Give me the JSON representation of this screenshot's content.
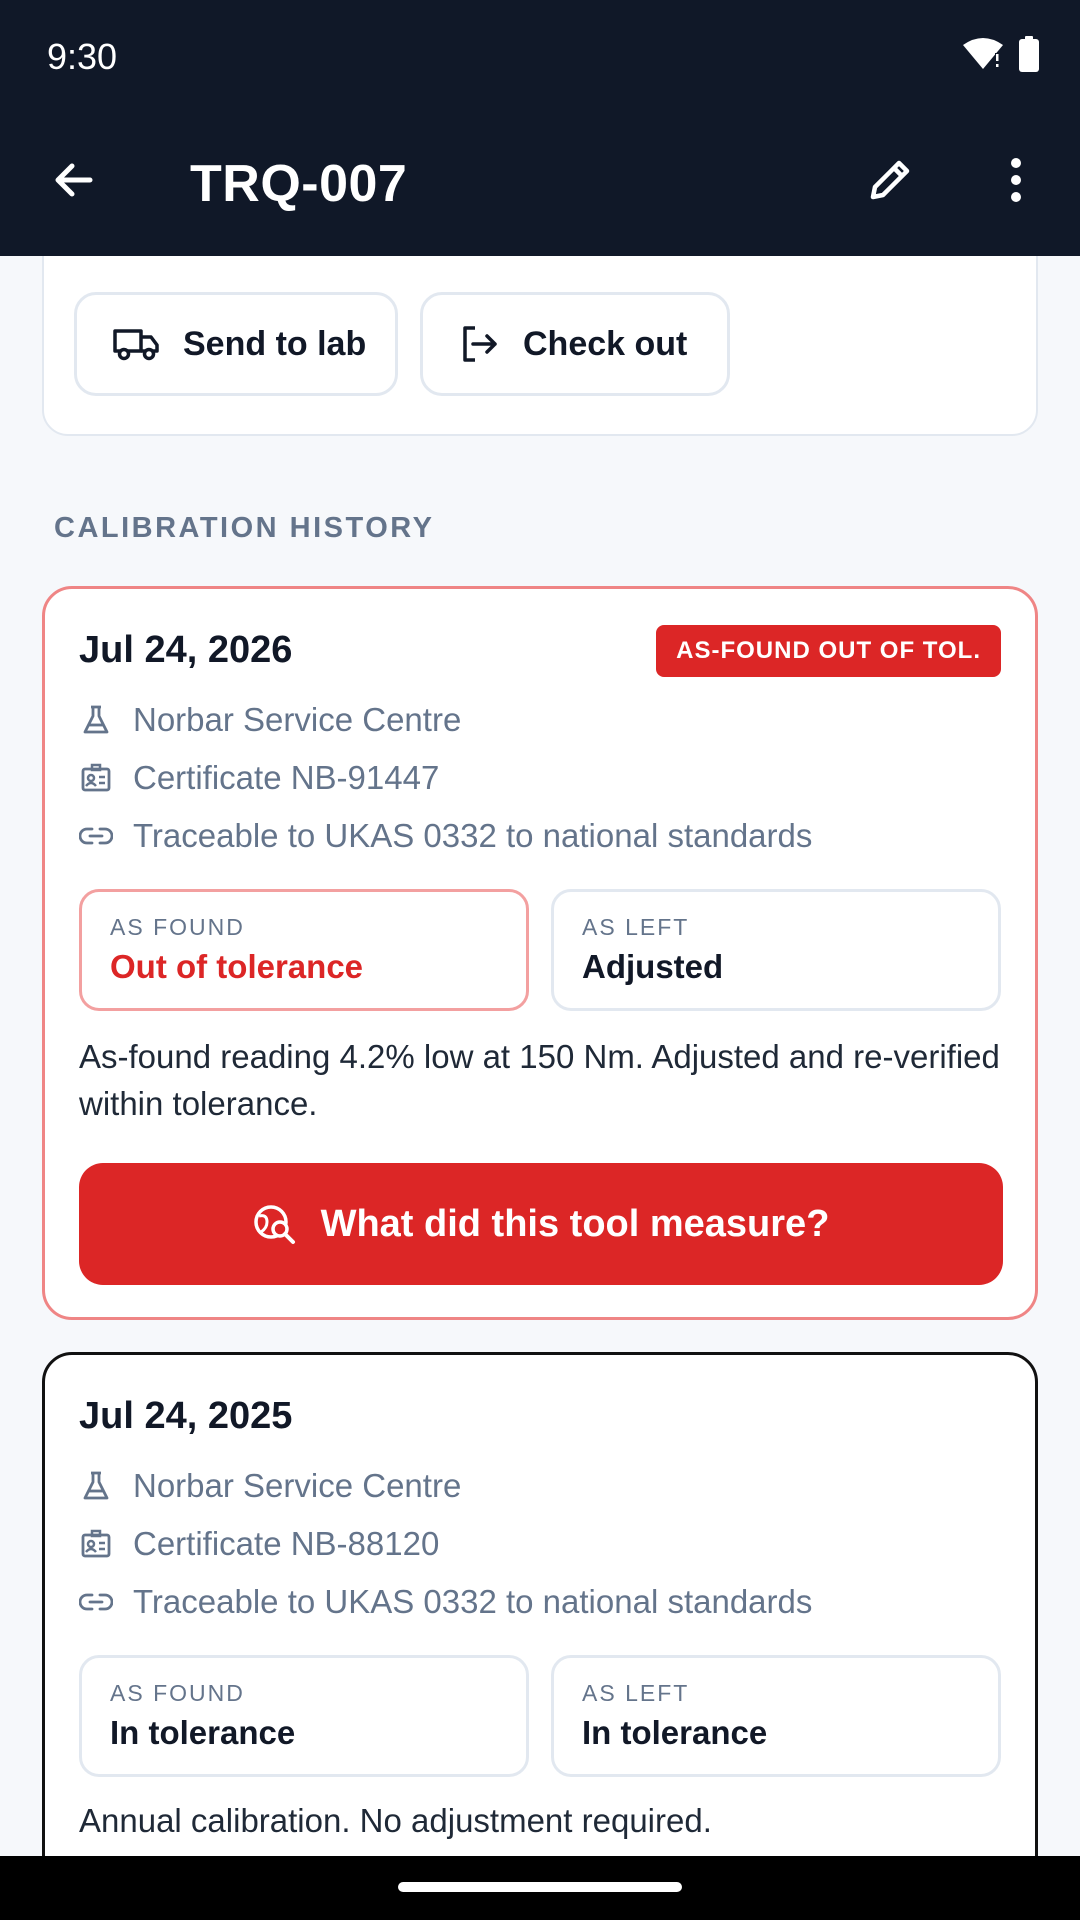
{
  "status_bar": {
    "time": "9:30"
  },
  "app_bar": {
    "title": "TRQ-007"
  },
  "actions": {
    "send_to_lab": "Send to lab",
    "check_out": "Check out"
  },
  "section": {
    "title": "CALIBRATION HISTORY"
  },
  "records": [
    {
      "date": "Jul 24, 2026",
      "badge": "AS-FOUND OUT OF TOL.",
      "lab": "Norbar Service Centre",
      "certificate": "Certificate NB-91447",
      "traceability": "Traceable to UKAS 0332 to national standards",
      "as_found_label": "AS FOUND",
      "as_found_value": "Out of tolerance",
      "as_left_label": "AS LEFT",
      "as_left_value": "Adjusted",
      "note": "As-found reading 4.2% low at 150 Nm. Adjusted and re-verified within tolerance.",
      "cta": "What did this tool measure?"
    },
    {
      "date": "Jul 24, 2025",
      "lab": "Norbar Service Centre",
      "certificate": "Certificate NB-88120",
      "traceability": "Traceable to UKAS 0332 to national standards",
      "as_found_label": "AS FOUND",
      "as_found_value": "In tolerance",
      "as_left_label": "AS LEFT",
      "as_left_value": "In tolerance",
      "note": "Annual calibration. No adjustment required."
    }
  ],
  "colors": {
    "header": "#101828",
    "danger": "#dc2626",
    "muted": "#64748b",
    "background": "#f6f8fb"
  },
  "icons": {
    "back": "arrow-left-icon",
    "edit": "pencil-icon",
    "more": "more-vert-icon",
    "truck": "truck-icon",
    "checkout": "logout-icon",
    "lab": "flask-icon",
    "certificate": "id-card-icon",
    "link": "link-icon",
    "search": "search-globe-icon",
    "wifi": "wifi-icon",
    "battery": "battery-icon"
  }
}
